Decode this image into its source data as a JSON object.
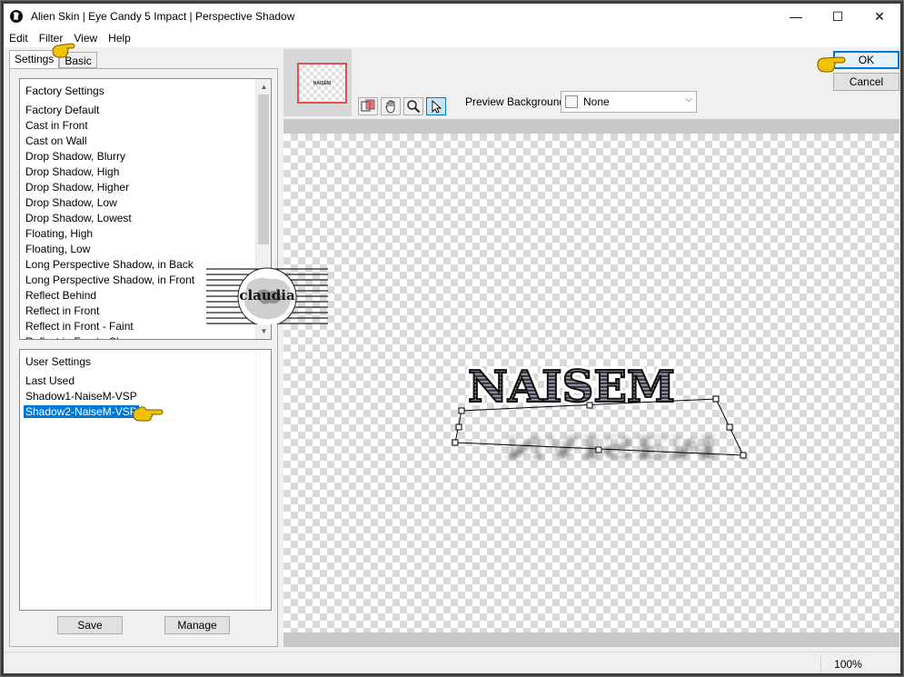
{
  "window": {
    "title": "Alien Skin | Eye Candy 5 Impact | Perspective Shadow",
    "controls": {
      "minimize": "—",
      "maximize": "☐",
      "close": "✕"
    }
  },
  "menu": [
    "Edit",
    "Filter",
    "View",
    "Help"
  ],
  "tabs": {
    "settings": "Settings",
    "basic": "Basic"
  },
  "factory": {
    "header": "Factory Settings",
    "items": [
      "Factory Default",
      "Cast in Front",
      "Cast on Wall",
      "Drop Shadow, Blurry",
      "Drop Shadow, High",
      "Drop Shadow, Higher",
      "Drop Shadow, Low",
      "Drop Shadow, Lowest",
      "Floating, High",
      "Floating, Low",
      "Long Perspective Shadow, in Back",
      "Long Perspective Shadow, in Front",
      "Reflect Behind",
      "Reflect in Front",
      "Reflect in Front - Faint",
      "Reflect in Front - Sh"
    ]
  },
  "user": {
    "header": "User Settings",
    "items": [
      "Last Used",
      "Shadow1-NaiseM-VSP",
      "Shadow2-NaiseM-VSP"
    ],
    "selected_index": 2
  },
  "buttons": {
    "save": "Save",
    "manage": "Manage",
    "ok": "OK",
    "cancel": "Cancel"
  },
  "preview": {
    "background_label": "Preview Background:",
    "background_value": "None",
    "thumbnail_text": "NAISEM",
    "text": "NAISEM",
    "tools": [
      "preview-toggle-icon",
      "hand-icon",
      "zoom-icon",
      "arrow-pointer-icon"
    ],
    "active_tool": "arrow-pointer-icon"
  },
  "watermark": {
    "text": "claudia"
  },
  "status": {
    "zoom": "100%"
  },
  "colors": {
    "selection": "#0078d7",
    "thumbnail_border": "#e05050",
    "pointer": "#f2c200"
  }
}
